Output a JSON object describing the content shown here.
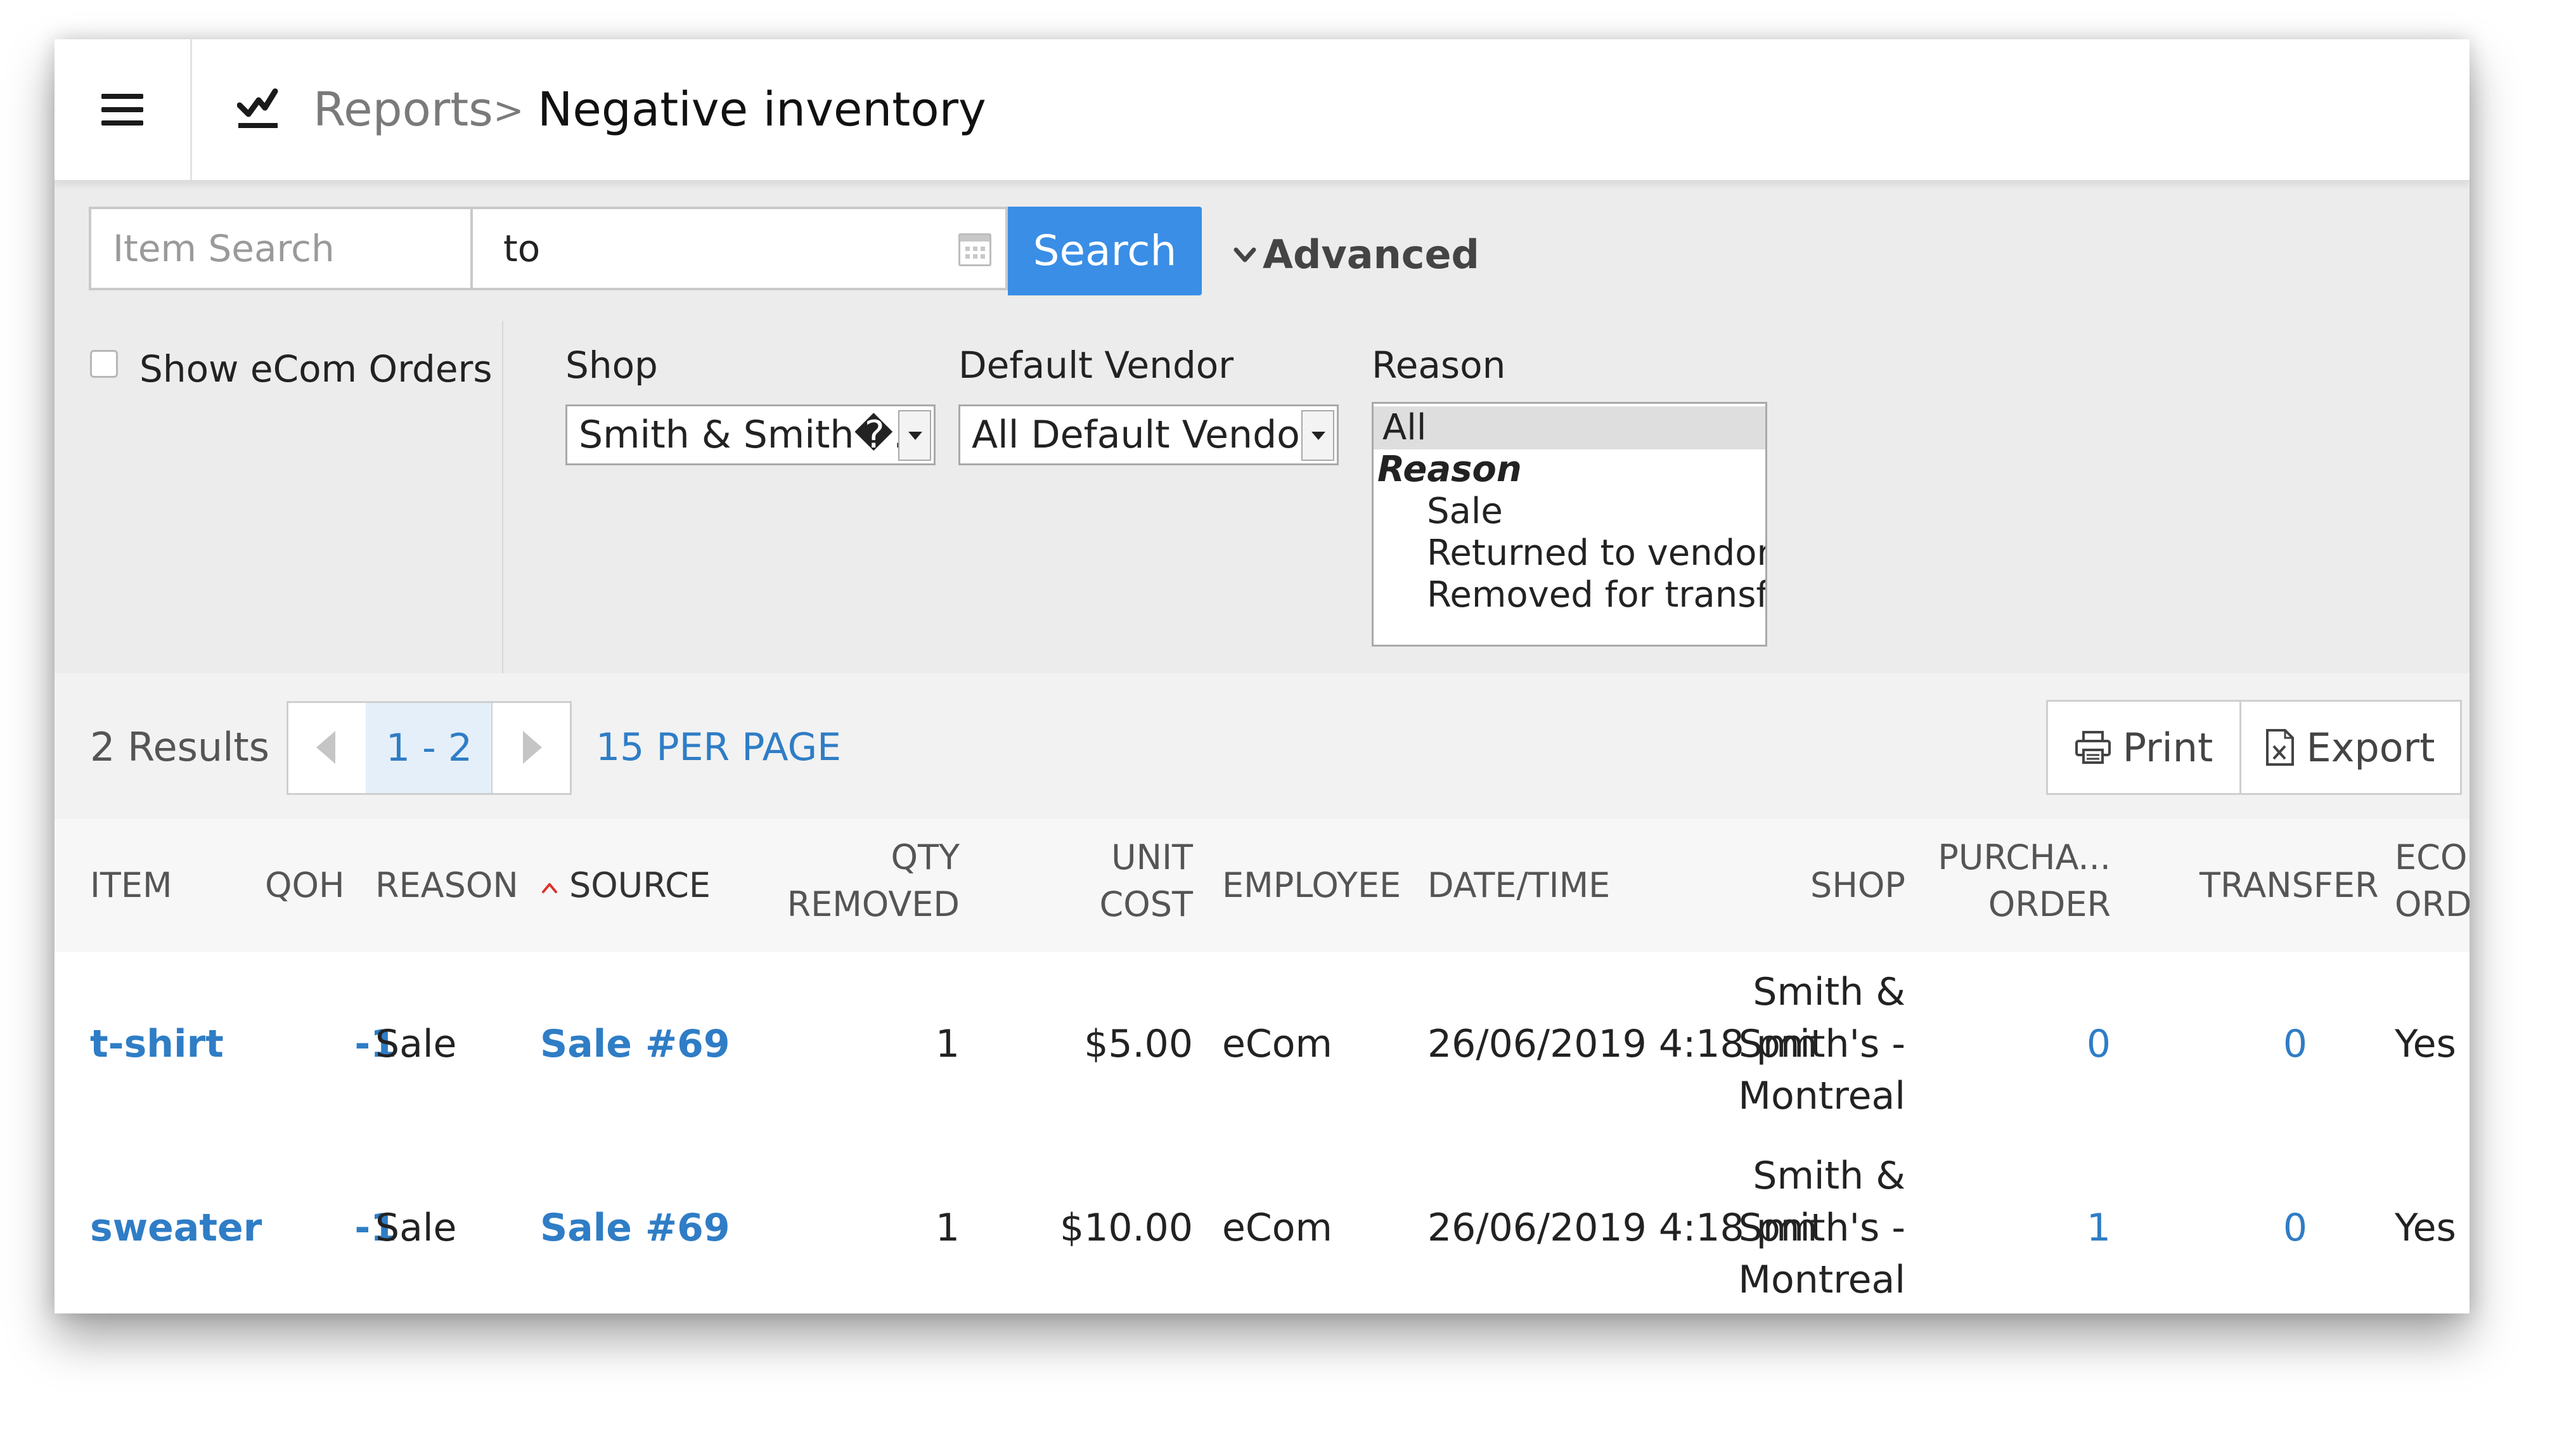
{
  "header": {
    "breadcrumb_parent": "Reports",
    "breadcrumb_separator": ">",
    "page_title": "Negative inventory"
  },
  "search": {
    "item_placeholder": "Item Search",
    "date_range_value": "to",
    "search_button": "Search",
    "advanced_label": "Advanced"
  },
  "filters": {
    "show_ecom_label": "Show eCom Orders",
    "show_ecom_checked": false,
    "shop_label": "Shop",
    "shop_value": "Smith & Smith�...",
    "vendor_label": "Default Vendor",
    "vendor_value": "All Default Vendors",
    "reason_label": "Reason",
    "reason_options": [
      {
        "text": "All",
        "selected": true,
        "group": false
      },
      {
        "text": "Reason",
        "selected": false,
        "group": true
      },
      {
        "text": "Sale",
        "selected": false,
        "group": false
      },
      {
        "text": "Returned to vendor",
        "selected": false,
        "group": false
      },
      {
        "text": "Removed for transfer",
        "selected": false,
        "group": false
      }
    ]
  },
  "results": {
    "count_label": "2 Results",
    "page_range": "1 - 2",
    "per_page": "15 PER PAGE",
    "print_label": "Print",
    "export_label": "Export"
  },
  "table": {
    "columns": {
      "item": "ITEM",
      "qoh": "QOH",
      "reason": "REASON",
      "source": "SOURCE",
      "qty_removed_1": "QTY",
      "qty_removed_2": "REMOVED",
      "unit_cost_1": "UNIT",
      "unit_cost_2": "COST",
      "employee": "EMPLOYEE",
      "datetime": "DATE/TIME",
      "shop": "SHOP",
      "purchase_1": "PURCHA...",
      "purchase_2": "ORDER",
      "transfer": "TRANSFER",
      "ecom_1": "ECOM",
      "ecom_2": "ORDER"
    },
    "rows": [
      {
        "item": "t-shirt",
        "qoh": "-1",
        "reason": "Sale",
        "source": "Sale #69",
        "qty_removed": "1",
        "unit_cost": "$5.00",
        "employee": "eCom",
        "datetime": "26/06/2019 4:18 pm",
        "shop_line1": "Smith &",
        "shop_line2": "Smith's -",
        "shop_line3": "Montreal",
        "purchase_order": "0",
        "transfer": "0",
        "ecom_order": "Yes"
      },
      {
        "item": "sweater",
        "qoh": "-1",
        "reason": "Sale",
        "source": "Sale #69",
        "qty_removed": "1",
        "unit_cost": "$10.00",
        "employee": "eCom",
        "datetime": "26/06/2019 4:18 pm",
        "shop_line1": "Smith &",
        "shop_line2": "Smith's -",
        "shop_line3": "Montreal",
        "purchase_order": "1",
        "transfer": "0",
        "ecom_order": "Yes"
      }
    ]
  },
  "colors": {
    "accent": "#3a8ee6",
    "link": "#2f7dc6",
    "sort_indicator": "#d9342b"
  }
}
